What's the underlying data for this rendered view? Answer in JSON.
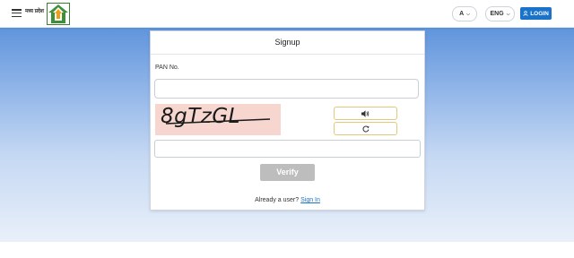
{
  "header": {
    "logo_text": "मध्य प्रदेश",
    "font_size_label": "A",
    "language_label": "ENG",
    "login_label": "LOGIN"
  },
  "signup": {
    "title": "Signup",
    "pan_label": "PAN No.",
    "pan_value": "",
    "captcha_text": "8gTzGL",
    "captcha_value": "",
    "verify_label": "Verify",
    "already_user_text": "Already a user?",
    "signin_label": "Sign In"
  },
  "icons": {
    "menu": "hamburger-icon",
    "logo": "house-logo-icon",
    "user": "user-icon",
    "audio": "speaker-icon",
    "refresh": "refresh-icon"
  },
  "colors": {
    "primary": "#1a73c8",
    "verify_disabled": "#bdbdbd",
    "captcha_bg": "#f6d6cf",
    "captcha_button_border": "#e0c97a"
  }
}
